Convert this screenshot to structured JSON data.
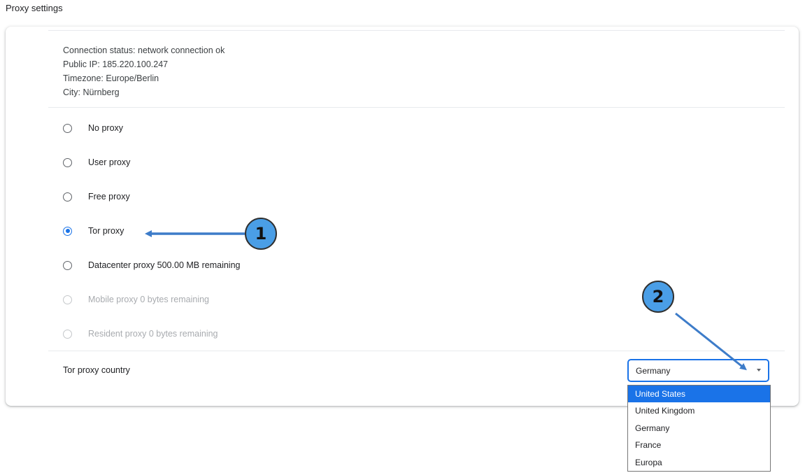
{
  "page": {
    "title": "Proxy settings"
  },
  "status": {
    "connection": "Connection status: network connection ok",
    "public_ip": "Public IP: 185.220.100.247",
    "timezone": "Timezone: Europe/Berlin",
    "city": "City: Nürnberg"
  },
  "proxy_options": [
    {
      "label": "No proxy",
      "checked": false,
      "disabled": false
    },
    {
      "label": "User proxy",
      "checked": false,
      "disabled": false
    },
    {
      "label": "Free proxy",
      "checked": false,
      "disabled": false
    },
    {
      "label": "Tor proxy",
      "checked": true,
      "disabled": false
    },
    {
      "label": "Datacenter proxy 500.00 MB remaining",
      "checked": false,
      "disabled": false
    },
    {
      "label": "Mobile proxy 0 bytes remaining",
      "checked": false,
      "disabled": true
    },
    {
      "label": "Resident proxy 0 bytes remaining",
      "checked": false,
      "disabled": true
    }
  ],
  "tor_country": {
    "label": "Tor proxy country",
    "selected": "Germany",
    "options": [
      "United States",
      "United Kingdom",
      "Germany",
      "France",
      "Europa"
    ],
    "highlighted": "United States"
  },
  "annotations": {
    "badge_1": "1",
    "badge_2": "2"
  },
  "colors": {
    "accent": "#1a73e8",
    "badge_fill": "#4a9ee6",
    "arrow": "#3d7cc9",
    "disabled_text": "#a8abaf"
  }
}
